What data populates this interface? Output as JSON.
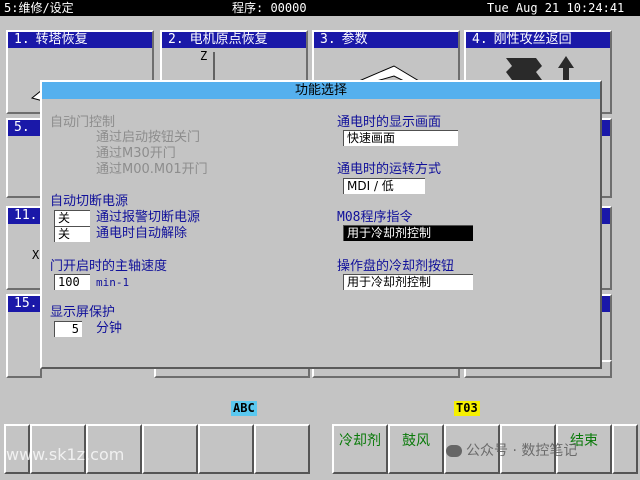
{
  "topbar": {
    "mode": "5:维修/设定",
    "program": "程序: 00000",
    "datetime": "Tue Aug 21 10:24:41"
  },
  "tiles": [
    {
      "num": "1.",
      "label": "转塔恢复"
    },
    {
      "num": "2.",
      "label": "电机原点恢复",
      "axis": "Z"
    },
    {
      "num": "3.",
      "label": "参数"
    },
    {
      "num": "4.",
      "label": "刚性攻丝返回"
    },
    {
      "num": "5.",
      "label": ""
    },
    {
      "num": "11.",
      "label": ""
    },
    {
      "num": "15.",
      "label": ""
    }
  ],
  "tile_fragment": "X",
  "dialog": {
    "title": "功能选择",
    "auto_door": {
      "heading": "自动门控制",
      "opt1": "通过启动按钮关门",
      "opt2": "通过M30开门",
      "opt3": "通过M00.M01开门"
    },
    "auto_power_off": {
      "heading": "自动切断电源",
      "opt1_value": "关",
      "opt1_label": "通过报警切断电源",
      "opt2_value": "关",
      "opt2_label": "通电时自动解除"
    },
    "door_spindle": {
      "heading": "门开启时的主轴速度",
      "value": "100",
      "unit": "min-1"
    },
    "screen_saver": {
      "heading": "显示屏保护",
      "value": "5",
      "unit": "分钟"
    },
    "power_on_screen": {
      "heading": "通电时的显示画面",
      "value": "快速画面"
    },
    "power_on_mode": {
      "heading": "通电时的运转方式",
      "value": "MDI / 低"
    },
    "m08": {
      "heading": "M08程序指令",
      "value": "用于冷却剂控制"
    },
    "coolant_button": {
      "heading": "操作盘的冷却剂按钮",
      "value": "用于冷却剂控制"
    }
  },
  "indicators": {
    "abc": "ABC",
    "tool": "T03"
  },
  "softkeys": [
    "",
    "",
    "",
    "",
    "",
    "冷却剂",
    "鼓风",
    "",
    "结束",
    ""
  ],
  "watermark": {
    "left": "www.sk1z.com",
    "right": "公众号 · 数控笔记"
  }
}
